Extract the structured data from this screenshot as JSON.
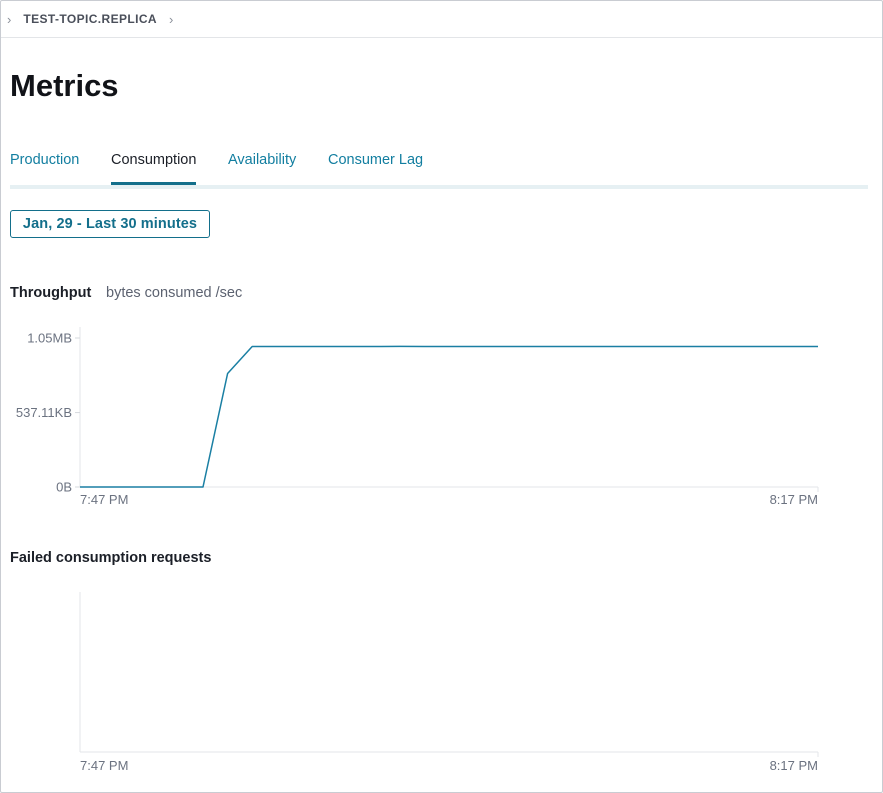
{
  "breadcrumb": {
    "label": "TEST-TOPIC.REPLICA"
  },
  "page": {
    "title": "Metrics"
  },
  "tabs": [
    {
      "label": "Production",
      "active": false
    },
    {
      "label": "Consumption",
      "active": true
    },
    {
      "label": "Availability",
      "active": false
    },
    {
      "label": "Consumer Lag",
      "active": false
    }
  ],
  "date_range": {
    "label": "Jan, 29 - Last 30 minutes"
  },
  "throughput": {
    "title": "Throughput",
    "subtitle": "bytes consumed /sec"
  },
  "failed": {
    "title": "Failed consumption requests"
  },
  "colors": {
    "accent": "#136f8b",
    "line": "#1a7fa3"
  },
  "chart_data": [
    {
      "type": "line",
      "title": "Throughput",
      "subtitle": "bytes consumed /sec",
      "y_tick_labels": [
        "1.05MB",
        "537.11KB",
        "0B"
      ],
      "y_ticks_mb": [
        1.05,
        0.5245,
        0
      ],
      "ylim_mb": [
        0,
        1.05
      ],
      "x_tick_labels": [
        "7:47 PM",
        "8:17 PM"
      ],
      "xlim_minutes": [
        0,
        30
      ],
      "grid": false,
      "series": [
        {
          "x_minutes": [
            0,
            5,
            6,
            7,
            8,
            10,
            12,
            13,
            14,
            15,
            16,
            18,
            20,
            22,
            24,
            26,
            28,
            30
          ],
          "y_mb": [
            0,
            0,
            0.8,
            0.99,
            0.99,
            0.99,
            0.99,
            0.991,
            0.99,
            0.99,
            0.99,
            0.99,
            0.99,
            0.99,
            0.99,
            0.99,
            0.99,
            0.99
          ]
        }
      ]
    },
    {
      "type": "line",
      "title": "Failed consumption requests",
      "x_tick_labels": [
        "7:47 PM",
        "8:17 PM"
      ],
      "xlim_minutes": [
        0,
        30
      ],
      "grid": false,
      "series": []
    }
  ]
}
